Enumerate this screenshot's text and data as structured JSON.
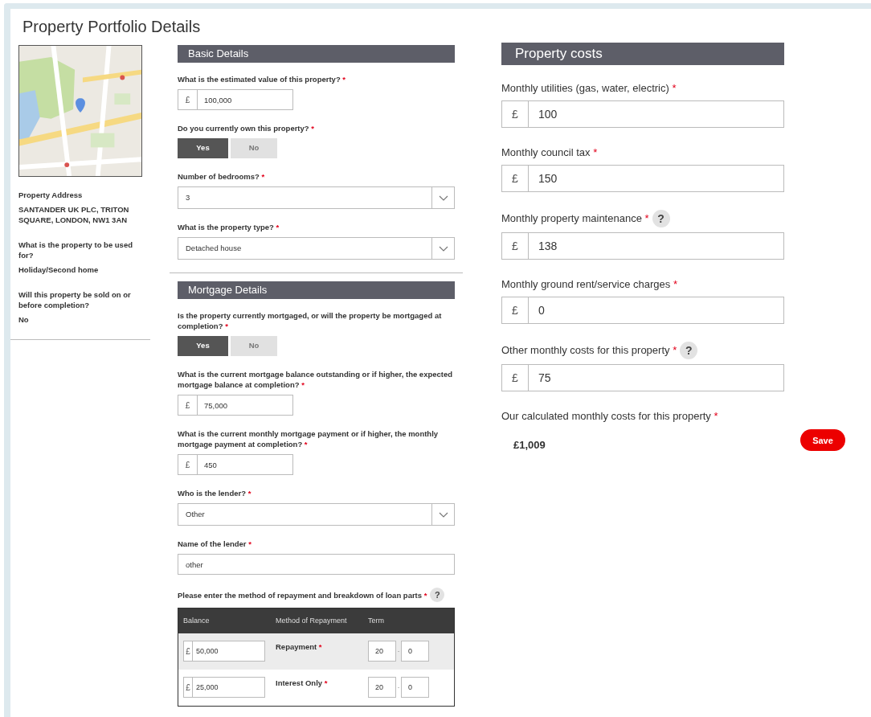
{
  "title": "Property Portfolio Details",
  "summary": [
    {
      "label": "Property Address",
      "value": "SANTANDER UK PLC, TRITON SQUARE, LONDON, NW1 3AN"
    },
    {
      "label": "What is the property to be used for?",
      "value": "Holiday/Second home"
    },
    {
      "label": "Will this property be sold on or before completion?",
      "value": "No"
    }
  ],
  "sections": [
    {
      "title": "Basic Details",
      "fields": [
        {
          "kind": "currency",
          "label": "What is the estimated value of this property?",
          "required_mark": "*",
          "currency": "£",
          "value": "100,000"
        },
        {
          "kind": "toggle",
          "label": "Do you currently own this property?",
          "required_mark": "*",
          "options": [
            {
              "label": "Yes",
              "selected": true
            },
            {
              "label": "No",
              "selected": false
            }
          ]
        },
        {
          "kind": "select",
          "label": "Number of bedrooms?",
          "required_mark": "*",
          "value": "3"
        },
        {
          "kind": "select",
          "label": "What is the property type?",
          "required_mark": "*",
          "value": "Detached house"
        }
      ]
    },
    {
      "title": "Mortgage Details",
      "fields": [
        {
          "kind": "toggle",
          "label": "Is the property currently mortgaged, or will the property be mortgaged at completion?",
          "required_mark": "*",
          "options": [
            {
              "label": "Yes",
              "selected": true
            },
            {
              "label": "No",
              "selected": false
            }
          ]
        },
        {
          "kind": "currency",
          "label": "What is the current mortgage balance outstanding or if higher, the expected mortgage balance at completion?",
          "required_mark": "*",
          "currency": "£",
          "value": "75,000"
        },
        {
          "kind": "currency",
          "label": "What is the current monthly mortgage payment or if higher, the monthly mortgage payment at completion?",
          "required_mark": "*",
          "currency": "£",
          "value": "450"
        },
        {
          "kind": "select",
          "label": "Who is the lender?",
          "required_mark": "*",
          "value": "Other"
        },
        {
          "kind": "text",
          "label": "Name of the lender",
          "required_mark": "*",
          "value": "other"
        },
        {
          "kind": "loan_table",
          "label": "Please enter the method of repayment and breakdown of loan parts",
          "required_mark": "*",
          "help": "?",
          "columns": [
            "Balance",
            "Method of Repayment",
            "Term"
          ],
          "rows": [
            {
              "currency": "£",
              "balance": "50,000",
              "method": "Repayment",
              "required_mark": "*",
              "term_years": "20",
              "term_separator": "-",
              "term_months": "0"
            },
            {
              "currency": "£",
              "balance": "25,000",
              "method": "Interest Only",
              "required_mark": "*",
              "term_years": "20",
              "term_separator": "-",
              "term_months": "0"
            }
          ]
        }
      ]
    }
  ],
  "costs": {
    "title": "Property costs",
    "fields": [
      {
        "label": "Monthly utilities (gas, water, electric)",
        "required_mark": "*",
        "currency": "£",
        "value": "100"
      },
      {
        "label": "Monthly council tax",
        "required_mark": "*",
        "currency": "£",
        "value": "150"
      },
      {
        "label": "Monthly property maintenance",
        "required_mark": "*",
        "help": "?",
        "currency": "£",
        "value": "138"
      },
      {
        "label": "Monthly ground rent/service charges",
        "required_mark": "*",
        "currency": "£",
        "value": "0"
      },
      {
        "label": "Other monthly costs for this property",
        "required_mark": "*",
        "help": "?",
        "currency": "£",
        "value": "75"
      }
    ],
    "total": {
      "label": "Our calculated monthly costs for this property",
      "required_mark": "*",
      "value": "£1,009"
    },
    "save": "Save"
  }
}
